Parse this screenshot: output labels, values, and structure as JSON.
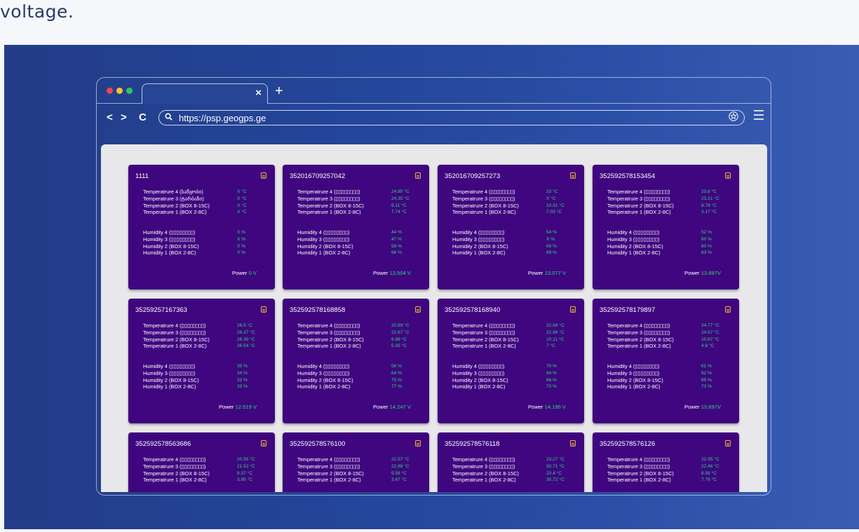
{
  "caption": "voltage.",
  "colors": {
    "card_bg": "#3f067f",
    "value_green": "#2bd67f",
    "icon_orange": "#f5b43b",
    "dot_red": "#f0474b",
    "dot_yellow": "#f7c42e",
    "dot_green": "#2ec856"
  },
  "browser": {
    "url": "https://psp.geogps.ge",
    "tab_close": "×",
    "new_tab": "+",
    "back": "<",
    "forward": ">",
    "reload": "C",
    "search_icon": "search-icon",
    "star_icon": "star-icon"
  },
  "power_label": "Power",
  "cards": [
    {
      "id": "1111",
      "temps": [
        {
          "label": "Temperatrure 4 (საწყობი)",
          "value": "X °C"
        },
        {
          "label": "Temperatrure 3 (ტარბაზი)",
          "value": "X °C"
        },
        {
          "label": "Temperatrure 2 (BOX 8-15C)",
          "value": "X °C"
        },
        {
          "label": "Temperatrure 1 (BOX 2-8C)",
          "value": "X °C"
        }
      ],
      "hums": [
        {
          "label": "Humidity 4 (▯▯▯▯▯▯▯▯)",
          "value": "X %"
        },
        {
          "label": "Humidity 3 (▯▯▯▯▯▯▯▯)",
          "value": "X %"
        },
        {
          "label": "Humidity 2 (BOX 8-15C)",
          "value": "X %"
        },
        {
          "label": "Humidity 1 (BOX 2-8C)",
          "value": "X %"
        }
      ],
      "power": "0 V"
    },
    {
      "id": "352016709257042",
      "temps": [
        {
          "label": "Temperatrure 4 (▯▯▯▯▯▯▯▯)",
          "value": "24.85 °C"
        },
        {
          "label": "Temperatrure 3 (▯▯▯▯▯▯▯▯)",
          "value": "24.35 °C"
        },
        {
          "label": "Temperatrure 2 (BOX 8-15C)",
          "value": "9.11 °C"
        },
        {
          "label": "Temperatrure 1 (BOX 2-8C)",
          "value": "7.74 °C"
        }
      ],
      "hums": [
        {
          "label": "Humidity 4 (▯▯▯▯▯▯▯▯)",
          "value": "44 %"
        },
        {
          "label": "Humidity 3 (▯▯▯▯▯▯▯▯)",
          "value": "47 %"
        },
        {
          "label": "Humidity 2 (BOX 8-15C)",
          "value": "58 %"
        },
        {
          "label": "Humidity 1 (BOX 2-8C)",
          "value": "66 %"
        }
      ],
      "power": "13.504 V"
    },
    {
      "id": "352016709257273",
      "temps": [
        {
          "label": "Temperatrure 4 (▯▯▯▯▯▯▯▯)",
          "value": "23 °C"
        },
        {
          "label": "Temperatrure 3 (▯▯▯▯▯▯▯▯)",
          "value": "X °C"
        },
        {
          "label": "Temperatrure 2 (BOX 8-15C)",
          "value": "10.31 °C"
        },
        {
          "label": "Temperatrure 1 (BOX 2-8C)",
          "value": "7.03 °C"
        }
      ],
      "hums": [
        {
          "label": "Humidity 4 (▯▯▯▯▯▯▯▯)",
          "value": "54 %"
        },
        {
          "label": "Humidity 3 (▯▯▯▯▯▯▯▯)",
          "value": "X %"
        },
        {
          "label": "Humidity 2 (BOX 8-15C)",
          "value": "69 %"
        },
        {
          "label": "Humidity 1 (BOX 2-8C)",
          "value": "69 %"
        }
      ],
      "power": "13.077 V"
    },
    {
      "id": "352592578153454",
      "temps": [
        {
          "label": "Temperatrure 4 (▯▯▯▯▯▯▯▯)",
          "value": "23.8 °C"
        },
        {
          "label": "Temperatrure 3 (▯▯▯▯▯▯▯▯)",
          "value": "23.21 °C"
        },
        {
          "label": "Temperatrure 2 (BOX 8-15C)",
          "value": "8.78 °C"
        },
        {
          "label": "Temperatrure 1 (BOX 2-8C)",
          "value": "3.17 °C"
        }
      ],
      "hums": [
        {
          "label": "Humidity 4 (▯▯▯▯▯▯▯▯)",
          "value": "52 %"
        },
        {
          "label": "Humidity 3 (▯▯▯▯▯▯▯▯)",
          "value": "60 %"
        },
        {
          "label": "Humidity 2 (BOX 8-15C)",
          "value": "60 %"
        },
        {
          "label": "Humidity 1 (BOX 2-8C)",
          "value": "63 %"
        }
      ],
      "power": "13.897V"
    },
    {
      "id": "35259257167363",
      "temps": [
        {
          "label": "Temperatrure 4 (▯▯▯▯▯▯▯▯)",
          "value": "26.5 °C"
        },
        {
          "label": "Temperatrure 3 (▯▯▯▯▯▯▯▯)",
          "value": "26.37 °C"
        },
        {
          "label": "Temperatrure 2 (BOX 8-15C)",
          "value": "26.39 °C"
        },
        {
          "label": "Temperatrure 1 (BOX 2-8C)",
          "value": "26.54 °C"
        }
      ],
      "hums": [
        {
          "label": "Humidity 4 (▯▯▯▯▯▯▯▯)",
          "value": "35 %"
        },
        {
          "label": "Humidity 3 (▯▯▯▯▯▯▯▯)",
          "value": "34 %"
        },
        {
          "label": "Humidity 2 (BOX 8-15C)",
          "value": "33 %"
        },
        {
          "label": "Humidity 1 (BOX 2-8C)",
          "value": "33 %"
        }
      ],
      "power": "12.519 V"
    },
    {
      "id": "352592578168858",
      "temps": [
        {
          "label": "Temperatrure 4 (▯▯▯▯▯▯▯▯)",
          "value": "20.89 °C"
        },
        {
          "label": "Temperatrure 3 (▯▯▯▯▯▯▯▯)",
          "value": "22.67 °C"
        },
        {
          "label": "Temperatrure 2 (BOX 8-15C)",
          "value": "9.88 °C"
        },
        {
          "label": "Temperatrure 1 (BOX 2-8C)",
          "value": "5.35 °C"
        }
      ],
      "hums": [
        {
          "label": "Humidity 4 (▯▯▯▯▯▯▯▯)",
          "value": "56 %"
        },
        {
          "label": "Humidity 3 (▯▯▯▯▯▯▯▯)",
          "value": "64 %"
        },
        {
          "label": "Humidity 2 (BOX 8-15C)",
          "value": "75 %"
        },
        {
          "label": "Humidity 1 (BOX 2-8C)",
          "value": "77 %"
        }
      ],
      "power": "14.247 V"
    },
    {
      "id": "352592578168940",
      "temps": [
        {
          "label": "Temperatrure 4 (▯▯▯▯▯▯▯▯)",
          "value": "22.98 °C"
        },
        {
          "label": "Temperatrure 3 (▯▯▯▯▯▯▯▯)",
          "value": "22.96 °C"
        },
        {
          "label": "Temperatrure 2 (BOX 8-15C)",
          "value": "10.11 °C"
        },
        {
          "label": "Temperatrure 1 (BOX 2-8C)",
          "value": "7 °C"
        }
      ],
      "hums": [
        {
          "label": "Humidity 4 (▯▯▯▯▯▯▯▯)",
          "value": "70 %"
        },
        {
          "label": "Humidity 3 (▯▯▯▯▯▯▯▯)",
          "value": "64 %"
        },
        {
          "label": "Humidity 2 (BOX 8-15C)",
          "value": "66 %"
        },
        {
          "label": "Humidity 1 (BOX 2-8C)",
          "value": "73 %"
        }
      ],
      "power": "14.196 V"
    },
    {
      "id": "352592578179897",
      "temps": [
        {
          "label": "Temperatrure 4 (▯▯▯▯▯▯▯▯)",
          "value": "24.77 °C"
        },
        {
          "label": "Temperatrure 3 (▯▯▯▯▯▯▯▯)",
          "value": "24.57 °C"
        },
        {
          "label": "Temperatrure 2 (BOX 8-15C)",
          "value": "10.67 °C"
        },
        {
          "label": "Temperatrure 1 (BOX 2-8C)",
          "value": "4.8 °C"
        }
      ],
      "hums": [
        {
          "label": "Humidity 4 (▯▯▯▯▯▯▯▯)",
          "value": "61 %"
        },
        {
          "label": "Humidity 3 (▯▯▯▯▯▯▯▯)",
          "value": "62 %"
        },
        {
          "label": "Humidity 2 (BOX 8-15C)",
          "value": "69 %"
        },
        {
          "label": "Humidity 1 (BOX 2-8C)",
          "value": "73 %"
        }
      ],
      "power": "13.897V"
    },
    {
      "id": "352592578563686",
      "temps": [
        {
          "label": "Temperatrure 4 (▯▯▯▯▯▯▯▯)",
          "value": "20.55 °C"
        },
        {
          "label": "Temperatrure 3 (▯▯▯▯▯▯▯▯)",
          "value": "21.52 °C"
        },
        {
          "label": "Temperatrure 2 (BOX 8-15C)",
          "value": "8.37 °C"
        },
        {
          "label": "Temperatrure 1 (BOX 2-8C)",
          "value": "3.95 °C"
        }
      ],
      "hums": [],
      "power": ""
    },
    {
      "id": "352592578576100",
      "temps": [
        {
          "label": "Temperatrure 4 (▯▯▯▯▯▯▯▯)",
          "value": "22.57 °C"
        },
        {
          "label": "Temperatrure 3 (▯▯▯▯▯▯▯▯)",
          "value": "22.88 °C"
        },
        {
          "label": "Temperatrure 2 (BOX 8-15C)",
          "value": "9.58 °C"
        },
        {
          "label": "Temperatrure 1 (BOX 2-8C)",
          "value": "3.87 °C"
        }
      ],
      "hums": [],
      "power": ""
    },
    {
      "id": "352592578576118",
      "temps": [
        {
          "label": "Temperatrure 4 (▯▯▯▯▯▯▯▯)",
          "value": "23.27 °C"
        },
        {
          "label": "Temperatrure 3 (▯▯▯▯▯▯▯▯)",
          "value": "30.71 °C"
        },
        {
          "label": "Temperatrure 2 (BOX 8-15C)",
          "value": "23.4 °C"
        },
        {
          "label": "Temperatrure 1 (BOX 2-8C)",
          "value": "30.72 °C"
        }
      ],
      "hums": [],
      "power": ""
    },
    {
      "id": "352592578576126",
      "temps": [
        {
          "label": "Temperatrure 4 (▯▯▯▯▯▯▯▯)",
          "value": "22.95 °C"
        },
        {
          "label": "Temperatrure 3 (▯▯▯▯▯▯▯▯)",
          "value": "22.46 °C"
        },
        {
          "label": "Temperatrure 2 (BOX 8-15C)",
          "value": "8.58 °C"
        },
        {
          "label": "Temperatrure 1 (BOX 2-8C)",
          "value": "7.76 °C"
        }
      ],
      "hums": [],
      "power": ""
    }
  ]
}
